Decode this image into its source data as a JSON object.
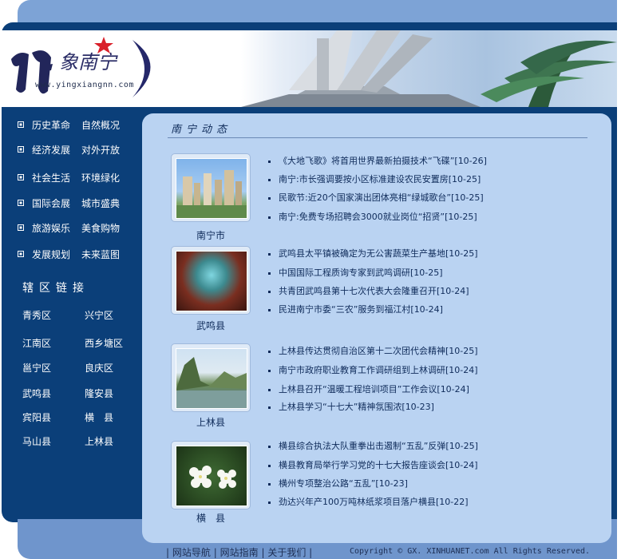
{
  "header": {
    "logo_url": "www.yingxiangnn.com"
  },
  "nav": {
    "rows": [
      [
        "历史革命",
        "自然概况"
      ],
      [
        "经济发展",
        "对外开放"
      ],
      [
        "社会生活",
        "环境绿化"
      ],
      [
        "国际会展",
        "城市盛典"
      ],
      [
        "旅游娱乐",
        "美食购物"
      ],
      [
        "发展规划",
        "未来蓝图"
      ]
    ]
  },
  "regions": {
    "title": "辖区链接",
    "rows": [
      [
        "青秀区",
        "兴宁区"
      ],
      [
        "江南区",
        "西乡塘区"
      ],
      [
        "邕宁区",
        "良庆区"
      ],
      [
        "武鸣县",
        "隆安县"
      ],
      [
        "宾阳县",
        "横　县"
      ],
      [
        "马山县",
        "上林县"
      ]
    ]
  },
  "main": {
    "title": "南宁动态",
    "sections": [
      {
        "caption": "南宁市",
        "items": [
          "《大地飞歌》将首用世界最新拍摄技术“飞碟”[10-26]",
          "南宁:市长强调要按小区标准建设农民安置房[10-25]",
          "民歌节:近20个国家演出团体亮相“绿城歌台”[10-25]",
          "南宁:免费专场招聘会3000就业岗位“招贤”[10-25]"
        ]
      },
      {
        "caption": "武鸣县",
        "items": [
          "武鸣县太平镇被确定为无公害蔬菜生产基地[10-25]",
          "中国国际工程质询专家到武鸣调研[10-25]",
          "共青团武鸣县第十七次代表大会隆重召开[10-24]",
          "民进南宁市委“三农”服务到福江村[10-24]"
        ]
      },
      {
        "caption": "上林县",
        "items": [
          "上林县传达贯彻自治区第十二次团代会精神[10-25]",
          "南宁市政府职业教育工作调研组到上林调研[10-24]",
          "上林县召开“温暖工程培训项目”工作会议[10-24]",
          "上林县学习“十七大”精神氛围浓[10-23]"
        ]
      },
      {
        "caption": "横　县",
        "items": [
          "横县综合执法大队重拳出击遏制“五乱”反弹[10-25]",
          "横县教育局举行学习党的十七大报告座谈会[10-24]",
          "横州专项整治公路“五乱”[10-23]",
          "劲达兴年产100万吨林纸浆项目落户横县[10-22]"
        ]
      }
    ]
  },
  "footer": {
    "links": [
      "网站导航",
      "网站指南",
      "关于我们"
    ],
    "copyright": "Copyright © GX. XINHUANET.com  All Rights Reserved."
  }
}
